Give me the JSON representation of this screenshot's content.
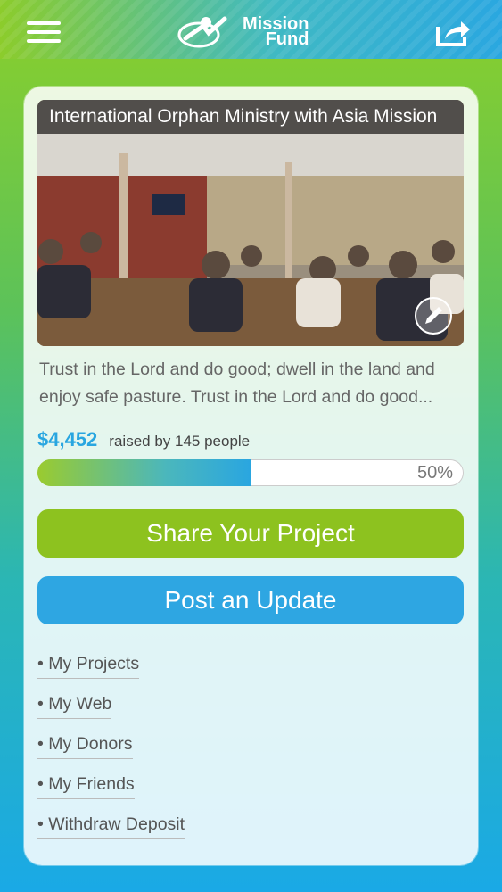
{
  "header": {
    "logo_line1": "Mission",
    "logo_line2": "Fund",
    "menu_icon": "hamburger-menu-icon",
    "share_icon": "share-export-icon",
    "colors": {
      "left": "#8ccc2b",
      "right": "#2aa7e0"
    }
  },
  "project": {
    "title": "International Orphan Ministry with Asia Mission",
    "description": "Trust in the Lord and do good; dwell in the land and enjoy safe pasture. Trust in the Lord and do good...",
    "amount": "$4,452",
    "raised_text": "raised by 145 people",
    "progress_label": "50%",
    "progress_fraction": 0.5,
    "edit_icon": "edit-pencil-icon"
  },
  "actions": {
    "share_label": "Share Your Project",
    "update_label": "Post an Update",
    "share_color": "#8dc21f",
    "update_color": "#2ea6e2"
  },
  "links": [
    {
      "label": "My Projects"
    },
    {
      "label": "My Web"
    },
    {
      "label": "My Donors"
    },
    {
      "label": "My Friends"
    },
    {
      "label": "Withdraw Deposit"
    }
  ]
}
